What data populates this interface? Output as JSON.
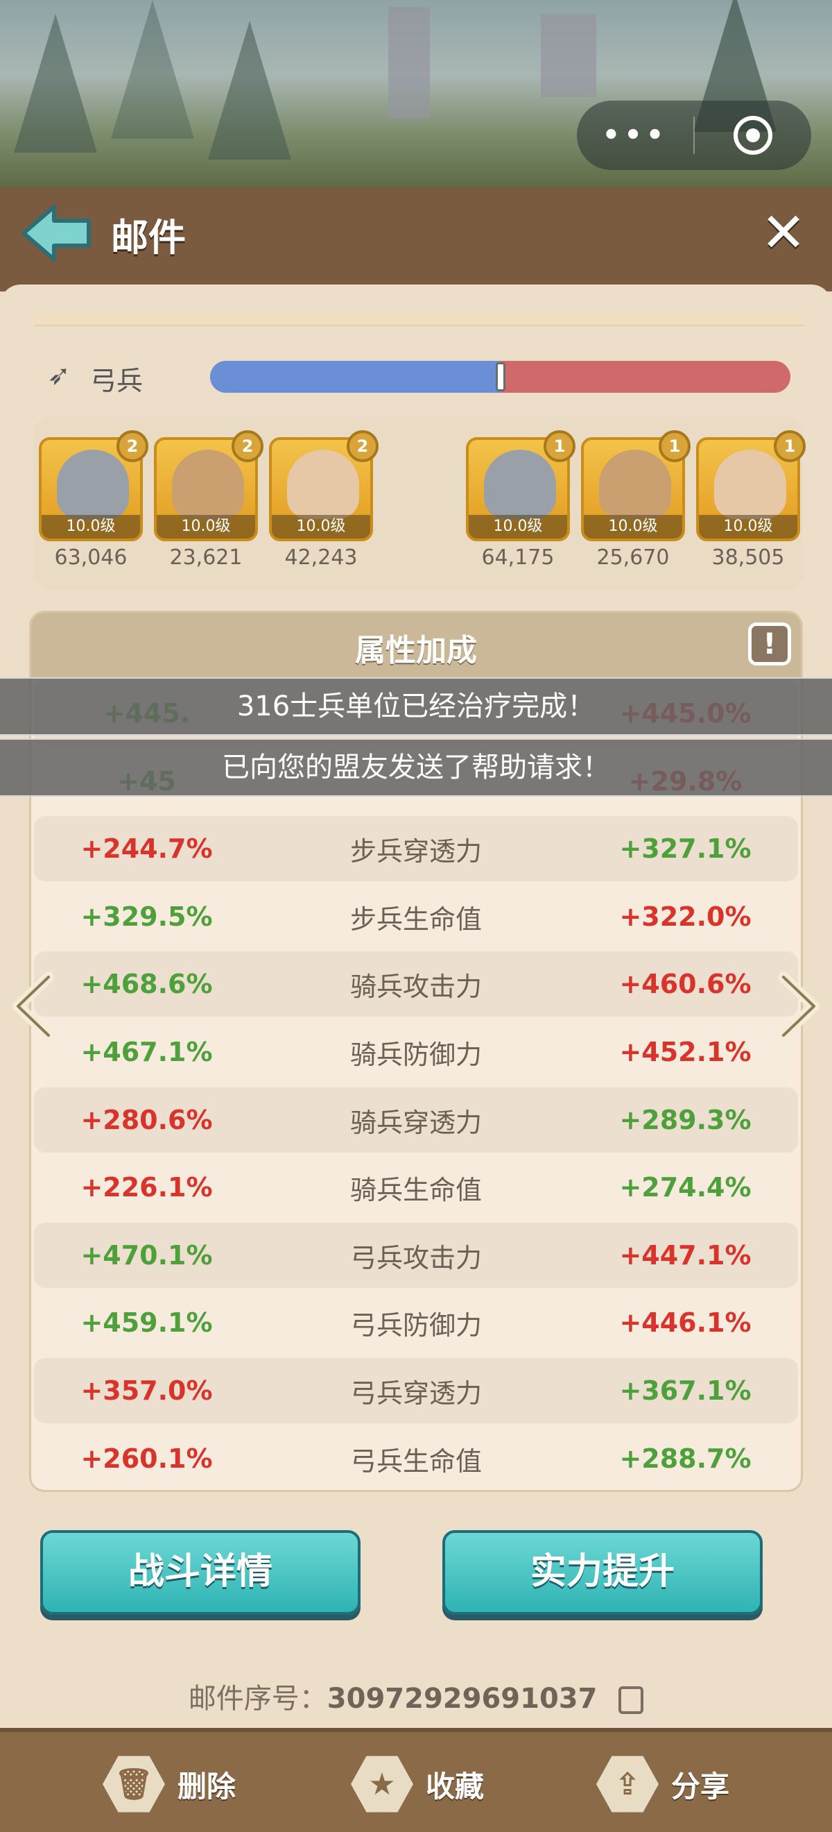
{
  "header": {
    "title": "邮件"
  },
  "troop": {
    "icon": "bow-icon",
    "label": "弓兵",
    "ratio": 0.5
  },
  "heroes": {
    "left": [
      {
        "level": "10.0级",
        "badge": "2",
        "count": "63,046",
        "kind": "knight"
      },
      {
        "level": "10.0级",
        "badge": "2",
        "count": "23,621",
        "kind": "dwarf"
      },
      {
        "level": "10.0级",
        "badge": "2",
        "count": "42,243",
        "kind": "archer"
      }
    ],
    "right": [
      {
        "level": "10.0级",
        "badge": "1",
        "count": "64,175",
        "kind": "knight"
      },
      {
        "level": "10.0级",
        "badge": "1",
        "count": "25,670",
        "kind": "dwarf"
      },
      {
        "level": "10.0级",
        "badge": "1",
        "count": "38,505",
        "kind": "archer"
      }
    ]
  },
  "attributes": {
    "title": "属性加成",
    "info_icon": "!",
    "rows": [
      {
        "left": "+445.",
        "name": "",
        "right": "+445.0%",
        "left_color": "green",
        "right_color": "red"
      },
      {
        "left": "+45",
        "name": "",
        "right": "+29.8%",
        "left_color": "green",
        "right_color": "red"
      },
      {
        "left": "+244.7%",
        "name": "步兵穿透力",
        "right": "+327.1%",
        "left_color": "red",
        "right_color": "green"
      },
      {
        "left": "+329.5%",
        "name": "步兵生命值",
        "right": "+322.0%",
        "left_color": "green",
        "right_color": "red"
      },
      {
        "left": "+468.6%",
        "name": "骑兵攻击力",
        "right": "+460.6%",
        "left_color": "green",
        "right_color": "red"
      },
      {
        "left": "+467.1%",
        "name": "骑兵防御力",
        "right": "+452.1%",
        "left_color": "green",
        "right_color": "red"
      },
      {
        "left": "+280.6%",
        "name": "骑兵穿透力",
        "right": "+289.3%",
        "left_color": "red",
        "right_color": "green"
      },
      {
        "left": "+226.1%",
        "name": "骑兵生命值",
        "right": "+274.4%",
        "left_color": "red",
        "right_color": "green"
      },
      {
        "left": "+470.1%",
        "name": "弓兵攻击力",
        "right": "+447.1%",
        "left_color": "green",
        "right_color": "red"
      },
      {
        "left": "+459.1%",
        "name": "弓兵防御力",
        "right": "+446.1%",
        "left_color": "green",
        "right_color": "red"
      },
      {
        "left": "+357.0%",
        "name": "弓兵穿透力",
        "right": "+367.1%",
        "left_color": "red",
        "right_color": "green"
      },
      {
        "left": "+260.1%",
        "name": "弓兵生命值",
        "right": "+288.7%",
        "left_color": "red",
        "right_color": "green"
      }
    ]
  },
  "toasts": {
    "first": "316士兵单位已经治疗完成！",
    "second": "已向您的盟友发送了帮助请求！"
  },
  "buttons": {
    "battle_details": "战斗详情",
    "power_up": "实力提升"
  },
  "serial": {
    "label": "邮件序号：",
    "value": "3097292969103",
    "value_tail": "7"
  },
  "footer": {
    "delete": "删除",
    "favorite": "收藏",
    "share": "分享"
  },
  "colors": {
    "green": "#4ea13a",
    "red": "#d9342b",
    "accent": "#2fb3b3",
    "header": "#7a5b3f"
  }
}
